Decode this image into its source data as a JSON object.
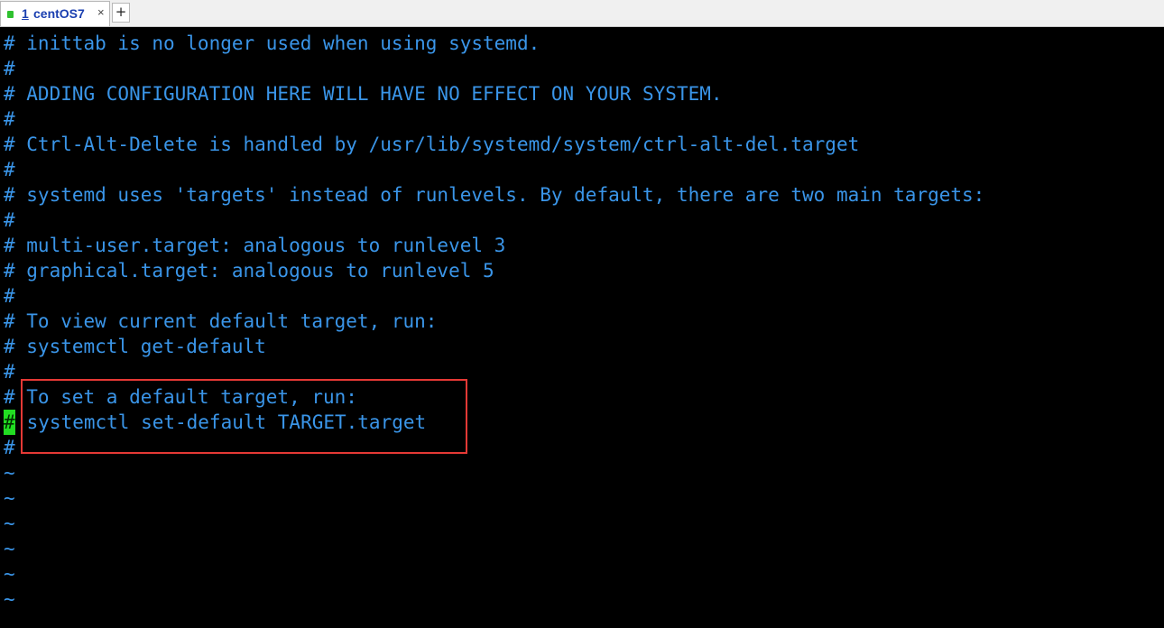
{
  "tab": {
    "number": "1",
    "name": "centOS7",
    "close_glyph": "×",
    "status_color": "#2fc12f"
  },
  "new_tab_glyph": "+",
  "terminal": {
    "text_color": "#3a95e8",
    "background": "#000000",
    "cursor_color": "#22dd22",
    "lines": [
      "# inittab is no longer used when using systemd.",
      "#",
      "# ADDING CONFIGURATION HERE WILL HAVE NO EFFECT ON YOUR SYSTEM.",
      "#",
      "# Ctrl-Alt-Delete is handled by /usr/lib/systemd/system/ctrl-alt-del.target",
      "#",
      "# systemd uses 'targets' instead of runlevels. By default, there are two main targets:",
      "#",
      "# multi-user.target: analogous to runlevel 3",
      "# graphical.target: analogous to runlevel 5",
      "#",
      "# To view current default target, run:",
      "# systemctl get-default",
      "#",
      "# To set a default target, run:",
      "# systemctl set-default TARGET.target",
      "#"
    ],
    "tilde": "~",
    "tilde_count": 6,
    "highlight_color": "#e53935"
  }
}
